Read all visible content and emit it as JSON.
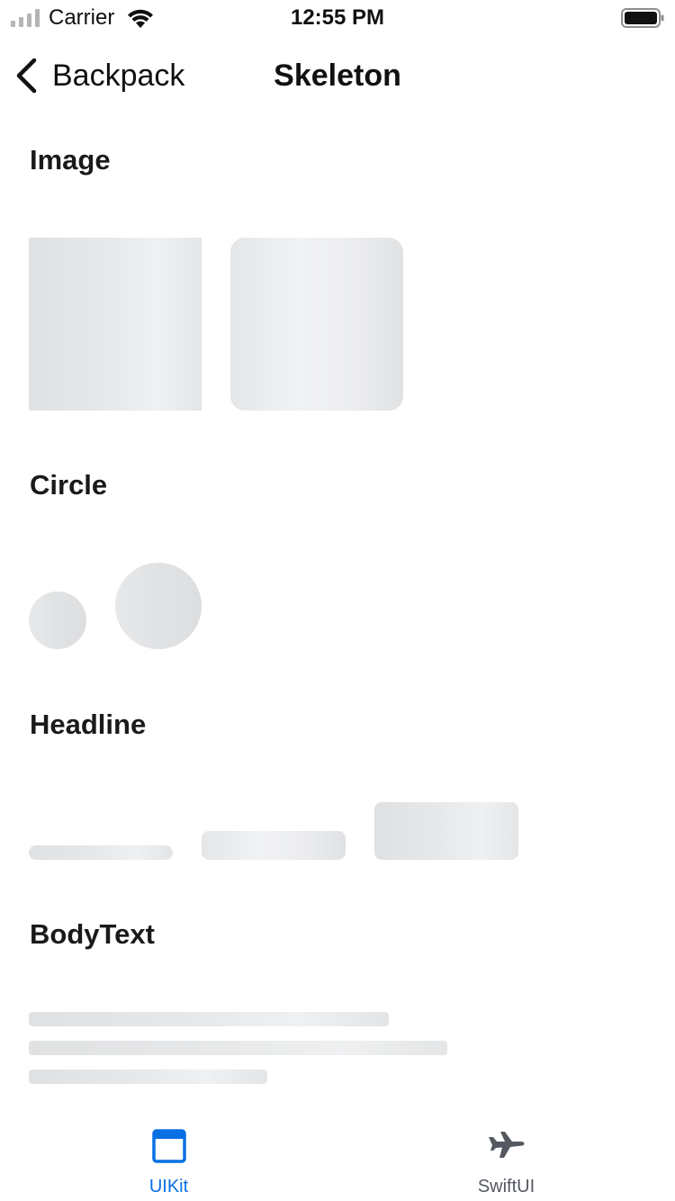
{
  "status_bar": {
    "carrier": "Carrier",
    "time": "12:55 PM",
    "signal_icon": "signal-icon",
    "wifi_icon": "wifi-icon",
    "battery_icon": "battery-icon"
  },
  "nav": {
    "back_label": "Backpack",
    "title": "Skeleton",
    "back_icon": "chevron-left-icon"
  },
  "sections": {
    "image": "Image",
    "circle": "Circle",
    "headline": "Headline",
    "body_text": "BodyText"
  },
  "tab_bar": {
    "active_color": "#0770e3",
    "inactive_color": "#545860",
    "tabs": [
      {
        "label": "UIKit",
        "icon": "window-icon",
        "selected": true
      },
      {
        "label": "SwiftUI",
        "icon": "airplane-icon",
        "selected": false
      }
    ]
  }
}
